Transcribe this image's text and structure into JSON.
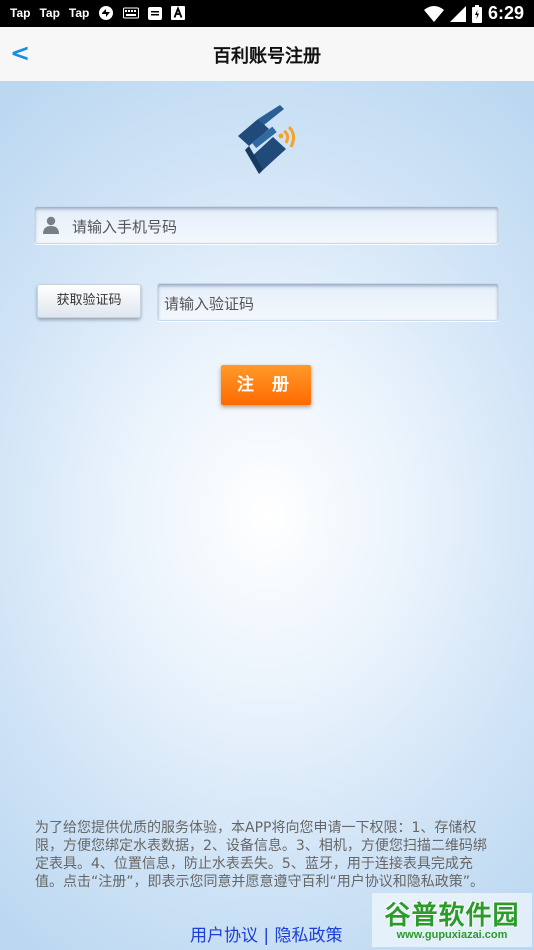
{
  "status_bar": {
    "apps": [
      "Tap",
      "Tap",
      "Tap"
    ],
    "time": "6:29",
    "icons": [
      "sync-icon",
      "keyboard-icon",
      "message-icon",
      "a-icon",
      "wifi-icon",
      "signal-icon",
      "battery-icon"
    ]
  },
  "app_bar": {
    "back_label": "<",
    "title": "百利账号注册"
  },
  "form": {
    "phone_placeholder": "请输入手机号码",
    "get_code_label": "获取验证码",
    "code_placeholder": "请输入验证码",
    "register_label": "注 册"
  },
  "notice": "为了给您提供优质的服务体验，本APP将向您申请一下权限：1、存储权限，方便您绑定水表数据，2、设备信息。3、相机，方便您扫描二维码绑定表具。4、位置信息，防止水表丢失。5、蓝牙，用于连接表具完成充值。点击“注册”，即表示您同意并愿意遵守百利“用户协议和隐私政策”。",
  "links": {
    "user_agreement": "用户协议",
    "separator": "|",
    "privacy_policy": "隐私政策"
  },
  "watermark": {
    "name": "谷普软件园",
    "url": "www.gupuxiazai.com"
  },
  "colors": {
    "accent_orange": "#ff7a10",
    "back_blue": "#1a8fe0",
    "link_blue": "#1b3fd9",
    "logo_blue": "#1f4a7a",
    "logo_orange": "#f5a22a"
  }
}
